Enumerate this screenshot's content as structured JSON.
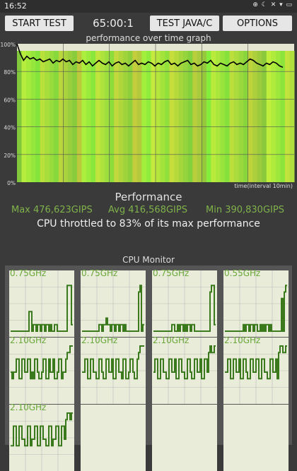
{
  "status": {
    "time": "16:52",
    "icons": "⊕ ☾ ✕ ▾ ▭"
  },
  "toolbar": {
    "start_label": "START TEST",
    "timer": "65:00:1",
    "java_label": "TEST JAVA/C",
    "options_label": "OPTIONS"
  },
  "graph": {
    "title": "performance over time graph",
    "x_label": "time(interval 10min)",
    "y_ticks": [
      "100%",
      "80%",
      "60%",
      "40%",
      "20%",
      "0%"
    ]
  },
  "performance": {
    "title": "Performance",
    "max": "Max 476,623GIPS",
    "avg": "Avg 416,568GIPS",
    "min": "Min 390,830GIPS",
    "throttle": "CPU throttled to 83% of its max performance"
  },
  "cpu_monitor": {
    "title": "CPU Monitor",
    "cores": [
      {
        "freq": "0.75GHz"
      },
      {
        "freq": "0.75GHz"
      },
      {
        "freq": "0.75GHz"
      },
      {
        "freq": "0.55GHz"
      },
      {
        "freq": "2.10GHz"
      },
      {
        "freq": "2.10GHz"
      },
      {
        "freq": "2.10GHz"
      },
      {
        "freq": "2.10GHz"
      },
      {
        "freq": "2.10GHz"
      },
      {
        "freq": ""
      },
      {
        "freq": ""
      },
      {
        "freq": ""
      }
    ]
  },
  "chart_data": {
    "type": "line",
    "title": "performance over time graph",
    "xlabel": "time(interval 10min)",
    "ylabel": "",
    "ylim": [
      0,
      100
    ],
    "y_unit": "%",
    "grid": true,
    "series": [
      {
        "values": [
          100,
          93,
          88,
          91,
          89,
          90,
          88,
          89,
          87,
          88,
          89,
          86,
          88,
          87,
          89,
          87,
          88,
          85,
          87,
          86,
          88,
          85,
          87,
          84,
          86,
          88,
          86,
          85,
          87,
          84,
          86,
          87,
          85,
          86,
          84,
          86,
          88,
          85,
          86,
          85,
          87,
          86,
          84,
          86,
          85,
          87,
          88,
          85,
          86,
          84,
          86,
          87,
          88,
          85,
          86,
          84,
          85,
          87,
          86,
          88,
          85,
          84,
          86,
          85,
          84,
          86,
          87,
          85,
          86,
          85,
          87,
          89,
          88,
          86,
          85,
          84,
          86,
          85,
          87,
          86,
          84,
          83
        ]
      }
    ]
  }
}
